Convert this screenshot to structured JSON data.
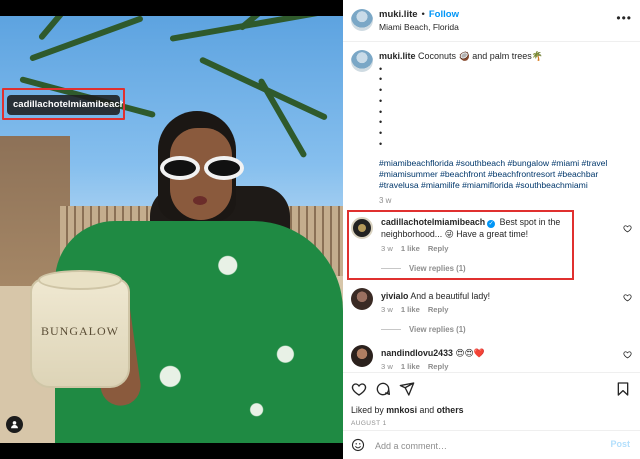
{
  "photo": {
    "tag_label": "cadillachotelmiamibeach",
    "cup_text": "BUNGALOW",
    "user_tag_icon": "user-icon"
  },
  "header": {
    "username": "muki.lite",
    "separator": "•",
    "follow_label": "Follow",
    "location": "Miami Beach, Florida",
    "more_icon": "more-horizontal-icon",
    "more_text": "•••"
  },
  "caption": {
    "username": "muki.lite",
    "text": "Coconuts 🥥 and palm trees🌴",
    "dots": [
      "•",
      "•",
      "•",
      "•",
      "•",
      "•",
      "•",
      "•"
    ],
    "hashtags": "#miamibeachflorida #southbeach #bungalow #miami #travel #miamisummer #beachfront #beachfrontresort #beachbar #travelusa #miamilife #miamiflorida #southbeachmiami",
    "time": "3 w"
  },
  "comments": [
    {
      "username": "cadillachotelmiamibeach",
      "verified": true,
      "text": "Best spot in the neighborhood... 😜 Have a great time!",
      "time": "3 w",
      "likes": "1 like",
      "reply_label": "Reply",
      "view_replies": "View replies (1)"
    },
    {
      "username": "yivialo",
      "verified": false,
      "text": "And a beautiful lady!",
      "time": "3 w",
      "likes": "1 like",
      "reply_label": "Reply",
      "view_replies": "View replies (1)"
    },
    {
      "username": "nandindlovu2433",
      "verified": false,
      "text": "😍😍❤️",
      "time": "3 w",
      "likes": "1 like",
      "reply_label": "Reply"
    }
  ],
  "actions": {
    "like_icon": "heart-icon",
    "comment_icon": "comment-icon",
    "share_icon": "send-icon",
    "save_icon": "bookmark-icon"
  },
  "liked_by": {
    "prefix": "Liked by",
    "user": "mnkosi",
    "and": "and",
    "others": "others"
  },
  "date": "AUGUST 1",
  "add_comment": {
    "emoji_icon": "emoji-icon",
    "placeholder": "Add a comment…",
    "post_label": "Post"
  },
  "colors": {
    "accent": "#0095f6",
    "highlight_border": "#e0302f",
    "hashtag": "#00376b",
    "muted": "#8e8e8e"
  }
}
